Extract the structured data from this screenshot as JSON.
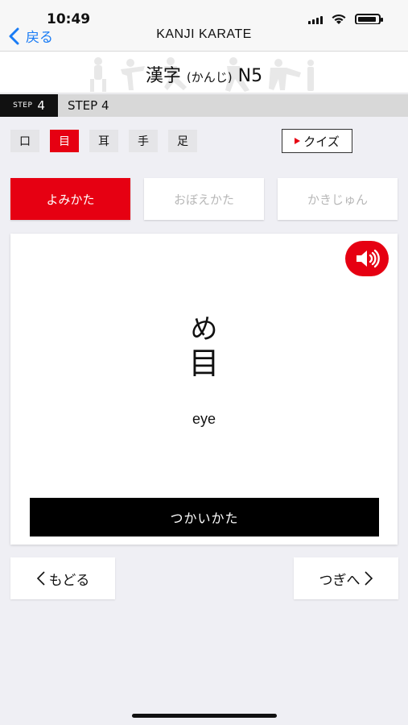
{
  "status": {
    "time": "10:49"
  },
  "nav": {
    "back_label": "戻る",
    "title": "KANJI KARATE"
  },
  "banner": {
    "title_main": "漢字",
    "title_reading": "(かんじ)",
    "title_level": "N5"
  },
  "step": {
    "tag_small": "STEP",
    "tag_num": "4",
    "name": "STEP 4"
  },
  "kanji_tabs": [
    "口",
    "目",
    "耳",
    "手",
    "足"
  ],
  "active_kanji_index": 1,
  "quiz": {
    "label": "クイズ"
  },
  "mode_tabs": [
    "よみかた",
    "おぼえかた",
    "かきじゅん"
  ],
  "card": {
    "reading": "め",
    "kanji": "目",
    "meaning": "eye",
    "usage_label": "つかいかた",
    "sound_icon": "speaker-icon"
  },
  "footer": {
    "prev_label": "もどる",
    "next_label": "つぎへ"
  },
  "colors": {
    "accent": "#e60012",
    "link": "#1a7cf5"
  }
}
